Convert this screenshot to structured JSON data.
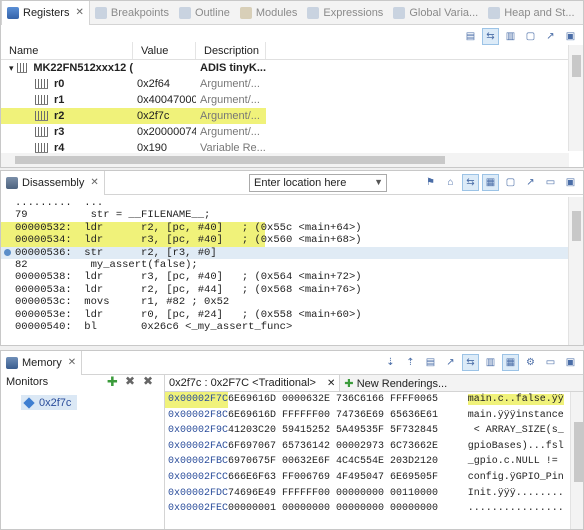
{
  "registers_view": {
    "tabs": [
      {
        "label": "Registers",
        "active": true
      },
      {
        "label": "Breakpoints"
      },
      {
        "label": "Outline"
      },
      {
        "label": "Modules"
      },
      {
        "label": "Expressions"
      },
      {
        "label": "Global Varia..."
      },
      {
        "label": "Heap and St..."
      }
    ],
    "columns": [
      "Name",
      "Value",
      "Description"
    ],
    "rows": [
      {
        "name": "MK22FN512xxx12 (",
        "value": "",
        "desc": "ADIS tinyK...",
        "root": true
      },
      {
        "name": "r0",
        "value": "0x2f64",
        "desc": "Argument/..."
      },
      {
        "name": "r1",
        "value": "0x40047000",
        "desc": "Argument/..."
      },
      {
        "name": "r2",
        "value": "0x2f7c",
        "desc": "Argument/...",
        "selected": true
      },
      {
        "name": "r3",
        "value": "0x20000074",
        "desc": "Argument/..."
      },
      {
        "name": "r4",
        "value": "0x190",
        "desc": "Variable Re..."
      }
    ]
  },
  "disassembly_view": {
    "tab_label": "Disassembly",
    "location_placeholder": "Enter location here",
    "lines": [
      {
        "text": ".........  ...",
        "type": "plain"
      },
      {
        "text": "79          str = __FILENAME__;",
        "type": "src"
      },
      {
        "text": "00000532:  ldr      r2, [pc, #40]   ; (0x55c <main+64>)",
        "type": "hl"
      },
      {
        "text": "00000534:  ldr      r3, [pc, #40]   ; (0x560 <main+68>)",
        "type": "hl"
      },
      {
        "text": "00000536:  str      r2, [r3, #0]",
        "type": "cur"
      },
      {
        "text": "82          my_assert(false);",
        "type": "src"
      },
      {
        "text": "00000538:  ldr      r3, [pc, #40]   ; (0x564 <main+72>)",
        "type": "plain"
      },
      {
        "text": "0000053a:  ldr      r2, [pc, #44]   ; (0x568 <main+76>)",
        "type": "plain"
      },
      {
        "text": "0000053c:  movs     r1, #82 ; 0x52",
        "type": "plain"
      },
      {
        "text": "0000053e:  ldr      r0, [pc, #24]   ; (0x558 <main+60>)",
        "type": "plain"
      },
      {
        "text": "00000540:  bl       0x26c6 <_my_assert_func>",
        "type": "plain"
      }
    ]
  },
  "memory_view": {
    "tab_label": "Memory",
    "monitors_label": "Monitors",
    "monitor_item": "0x2f7c",
    "rendering_tab": "0x2f7c : 0x2F7C <Traditional>",
    "new_renderings": "New Renderings...",
    "rows": [
      {
        "addr": "0x00002F7C",
        "hex": "6E69616D 0000632E 736C6166 FFFF0065",
        "ascii": "main.c..false.ÿÿ"
      },
      {
        "addr": "0x00002F8C",
        "hex": "6E69616D FFFFFF00 74736E69 65636E61",
        "ascii": "main.ÿÿÿinstance"
      },
      {
        "addr": "0x00002F9C",
        "hex": "41203C20 59415252 5A49535F 5F732845",
        "ascii": " < ARRAY_SIZE(s_"
      },
      {
        "addr": "0x00002FAC",
        "hex": "6F697067 65736142 00002973 6C73662E",
        "ascii": "gpioBases)...fsl"
      },
      {
        "addr": "0x00002FBC",
        "hex": "6970675F 00632E6F 4C4C554E 203D2120",
        "ascii": "_gpio.c.NULL != "
      },
      {
        "addr": "0x00002FCC",
        "hex": "666E6F63 FF006769 4F495047 6E69505F",
        "ascii": "config.ÿGPIO_Pin"
      },
      {
        "addr": "0x00002FDC",
        "hex": "74696E49 FFFFFF00 00000000 00110000",
        "ascii": "Init.ÿÿÿ........"
      },
      {
        "addr": "0x00002FEC",
        "hex": "00000001 00000000 00000000 00000000",
        "ascii": "................"
      }
    ]
  }
}
